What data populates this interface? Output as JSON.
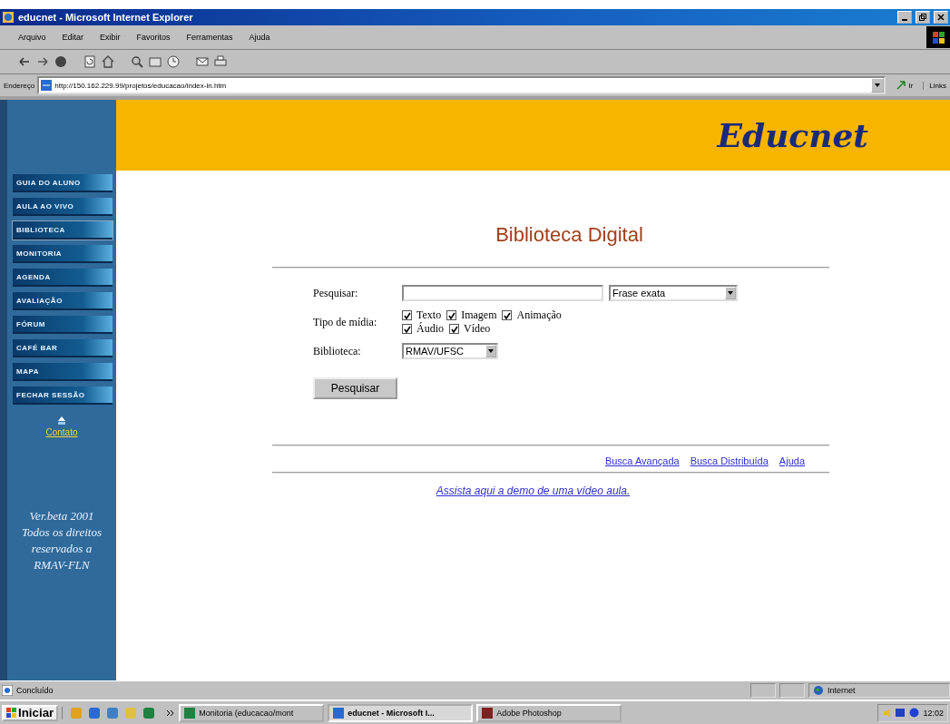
{
  "window": {
    "title": "educnet - Microsoft Internet Explorer"
  },
  "menu": [
    "Arquivo",
    "Editar",
    "Exibir",
    "Favoritos",
    "Ferramentas",
    "Ajuda"
  ],
  "address": {
    "label": "Endereço",
    "url": "http://150.162.229.99/projetos/educacao/index-in.htm",
    "go": "Ir",
    "links": "Links"
  },
  "sidebar": {
    "items": [
      {
        "label": "GUIA DO ALUNO",
        "selected": false
      },
      {
        "label": "AULA AO VIVO",
        "selected": false
      },
      {
        "label": "BIBLIOTECA",
        "selected": true
      },
      {
        "label": "MONITORIA",
        "selected": false
      },
      {
        "label": "AGENDA",
        "selected": false
      },
      {
        "label": "AVALIAÇÃO",
        "selected": false
      },
      {
        "label": "FÓRUM",
        "selected": false
      },
      {
        "label": "CAFÉ BAR",
        "selected": false
      },
      {
        "label": "MAPA",
        "selected": false
      },
      {
        "label": "FECHAR SESSÃO",
        "selected": false
      }
    ],
    "contact": "Contato",
    "footer": "Ver.beta 2001 Todos os direitos reservados a RMAV-FLN"
  },
  "header": {
    "logo": "Educnet"
  },
  "page": {
    "title": "Biblioteca Digital",
    "search_label": "Pesquisar:",
    "mode": "Frase exata",
    "media_label": "Tipo de mídia:",
    "media": [
      {
        "label": "Texto",
        "checked": true
      },
      {
        "label": "Imagem",
        "checked": true
      },
      {
        "label": "Animação",
        "checked": true
      },
      {
        "label": "Áudio",
        "checked": true
      },
      {
        "label": "Vídeo",
        "checked": true
      }
    ],
    "library_label": "Biblioteca:",
    "library": "RMAV/UFSC",
    "button": "Pesquisar",
    "links": [
      "Busca Avançada",
      "Busca Distribuída",
      "Ajuda"
    ],
    "demo": "Assista aqui a demo de uma vídeo aula."
  },
  "status_bar": {
    "text": "Concluído",
    "zone": "Internet"
  },
  "taskbar": {
    "start": "Iniciar",
    "tasks": [
      {
        "label": "Monitoria (educacao/mont",
        "selected": false
      },
      {
        "label": "educnet - Microsoft I...",
        "selected": true
      },
      {
        "label": "Adobe Photoshop",
        "selected": false
      }
    ],
    "clock": "12:02"
  }
}
